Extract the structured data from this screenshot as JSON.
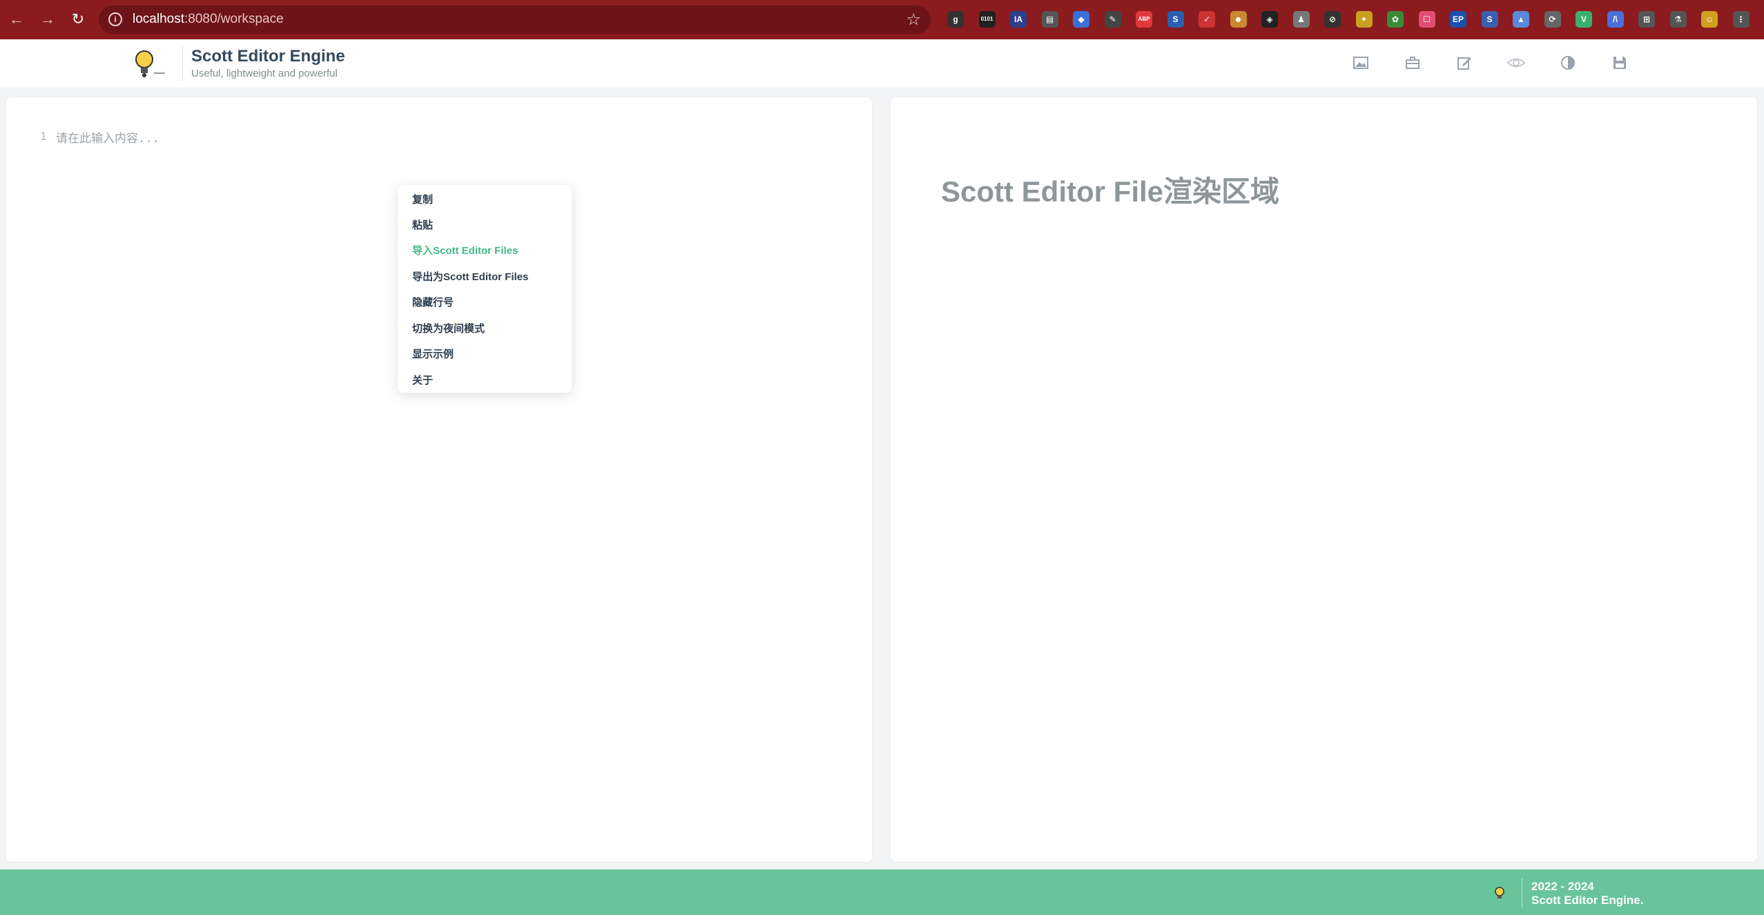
{
  "browser": {
    "url_host": "localhost",
    "url_rest": ":8080/workspace",
    "extensions": [
      "g",
      "0101",
      "IA",
      "▤",
      "◆",
      "✎",
      "ABP",
      "S",
      "✓",
      "☻",
      "◈",
      "♟",
      "⊘",
      "✦",
      "✿",
      "☐",
      "EP",
      "S",
      "▲",
      "⟳",
      "V",
      "/\\",
      "⊞",
      "⚗",
      "☺",
      "⋮"
    ]
  },
  "header": {
    "title": "Scott Editor Engine",
    "subtitle": "Useful, lightweight and powerful",
    "tools": [
      "image-icon",
      "toolbox-icon",
      "edit-icon",
      "eye-icon",
      "contrast-icon",
      "save-icon"
    ]
  },
  "editor": {
    "line_number": "1",
    "placeholder": "请在此输入内容..."
  },
  "preview": {
    "title": "Scott Editor File渲染区域"
  },
  "context_menu": {
    "items": [
      {
        "label": "复制"
      },
      {
        "label": "粘贴"
      },
      {
        "label": "导入Scott Editor Files",
        "active": true
      },
      {
        "label": "导出为Scott Editor Files"
      },
      {
        "label": "隐藏行号"
      },
      {
        "label": "切换为夜间模式"
      },
      {
        "label": "显示示例"
      },
      {
        "label": "关于"
      }
    ]
  },
  "footer": {
    "years": "2022 - 2024",
    "name": "Scott Editor Engine."
  },
  "colors": {
    "browser_bar": "#8b1b1f",
    "accent": "#42b883",
    "footer": "#68c49a"
  }
}
